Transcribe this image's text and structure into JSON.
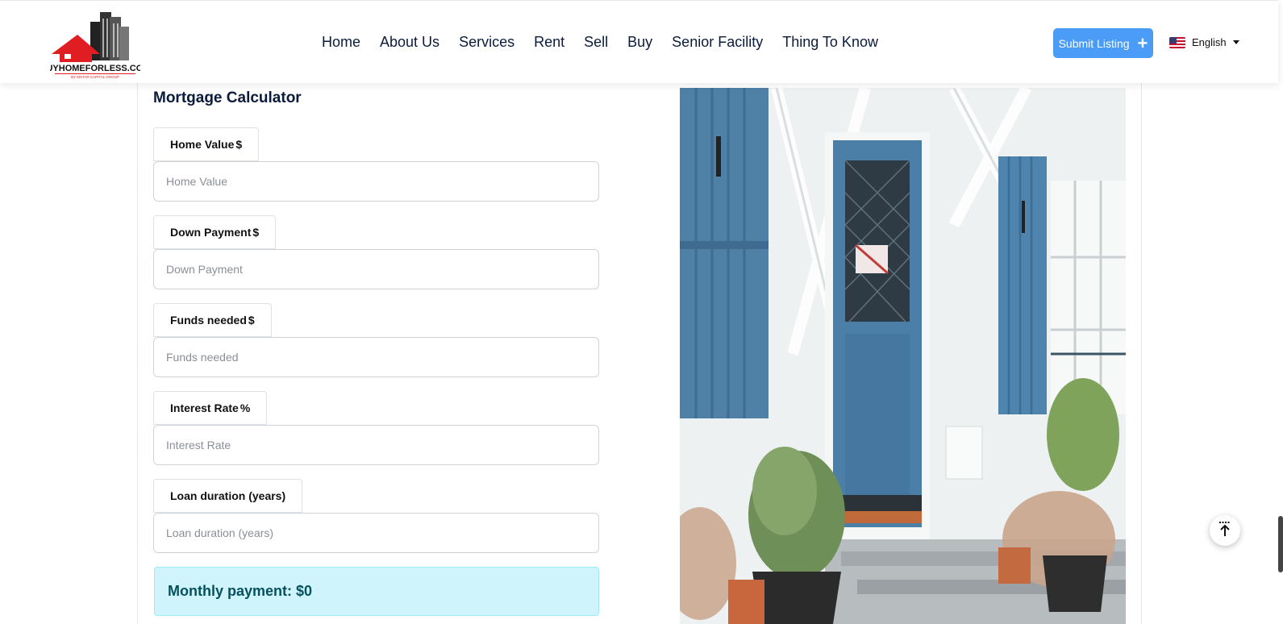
{
  "header": {
    "logo_text": "BUYHOMEFORLESS.COM",
    "logo_subtext": "BY MSTAR CAPITAL GROUP",
    "nav": [
      "Home",
      "About Us",
      "Services",
      "Rent",
      "Sell",
      "Buy",
      "Senior Facility",
      "Thing To Know"
    ],
    "submit_label": "Submit Listing",
    "submit_icon": "plus-icon",
    "language": "English",
    "language_icon": "us-flag-icon"
  },
  "calculator": {
    "title": "Mortgage Calculator",
    "fields": [
      {
        "label": "Home Value",
        "symbol": "$",
        "placeholder": "Home Value"
      },
      {
        "label": "Down Payment",
        "symbol": "$",
        "placeholder": "Down Payment"
      },
      {
        "label": "Funds needed",
        "symbol": "$",
        "placeholder": "Funds needed"
      },
      {
        "label": "Interest Rate",
        "symbol": "%",
        "placeholder": "Interest Rate"
      },
      {
        "label": "Loan duration (years)",
        "symbol": "",
        "placeholder": "Loan duration (years)"
      }
    ],
    "result": "Monthly payment: $0"
  },
  "scroll_top_icon": "arrow-up-icon"
}
